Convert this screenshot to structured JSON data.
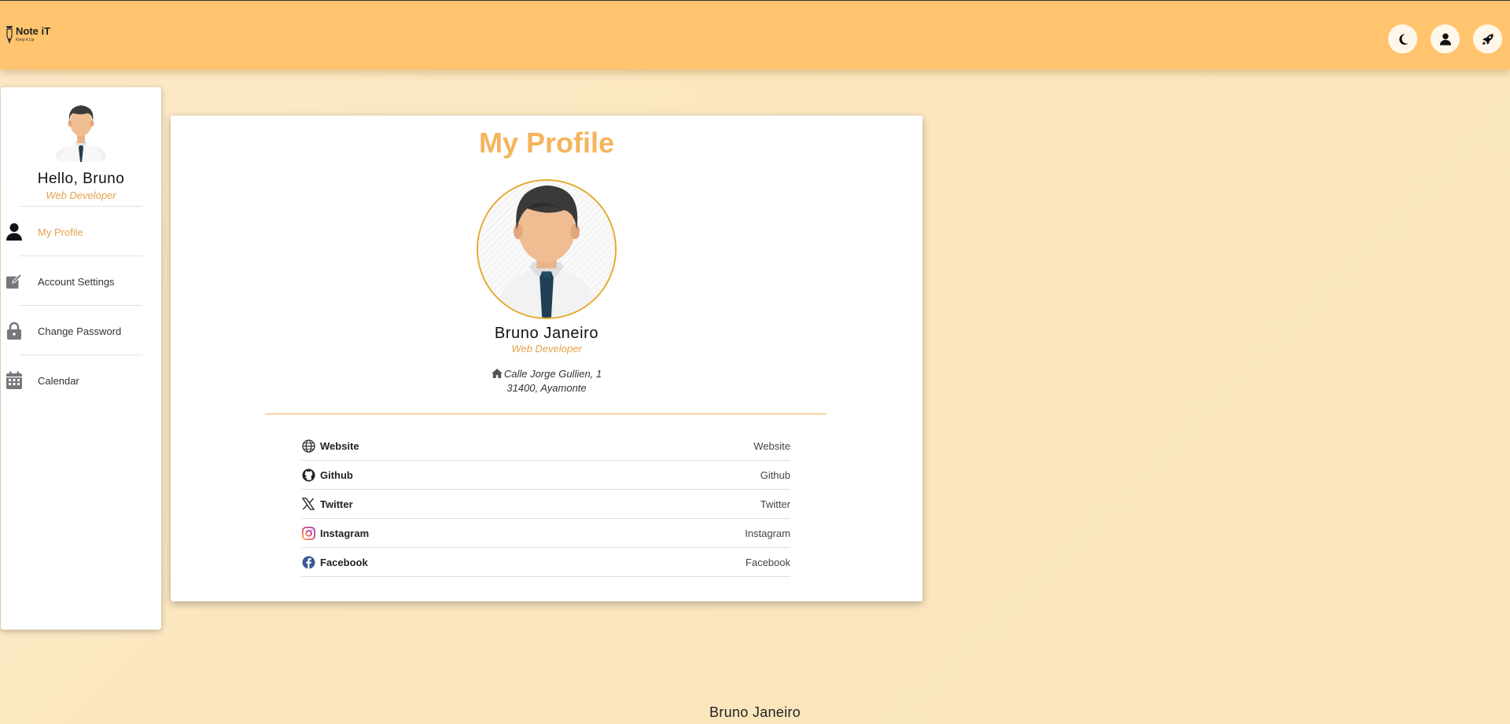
{
  "header": {
    "logo_name": "Note iT",
    "logo_tagline": "Keep it Up",
    "buttons": [
      {
        "icon": "moon-icon"
      },
      {
        "icon": "user-icon"
      },
      {
        "icon": "rocket-icon"
      }
    ]
  },
  "sidebar": {
    "greeting": "Hello, Bruno",
    "role": "Web Developer",
    "items": [
      {
        "label": "My Profile",
        "icon": "user-icon",
        "active": true
      },
      {
        "label": "Account Settings",
        "icon": "edit-icon"
      },
      {
        "label": "Change Password",
        "icon": "lock-icon"
      },
      {
        "label": "Calendar",
        "icon": "calendar-icon"
      }
    ]
  },
  "profile": {
    "title": "My Profile",
    "name": "Bruno Janeiro",
    "role": "Web Developer",
    "address_line1": "Calle Jorge Gullien, 1",
    "address_line2": "31400, Ayamonte",
    "links": [
      {
        "name": "Website",
        "value": "Website",
        "icon": "globe-icon"
      },
      {
        "name": "Github",
        "value": "Github",
        "icon": "github-icon"
      },
      {
        "name": "Twitter",
        "value": "Twitter",
        "icon": "x-twitter-icon"
      },
      {
        "name": "Instagram",
        "value": "Instagram",
        "icon": "instagram-icon"
      },
      {
        "name": "Facebook",
        "value": "Facebook",
        "icon": "facebook-icon"
      }
    ]
  },
  "colors": {
    "header_bg": "#ffc46d",
    "accent": "#f6b45c",
    "role_text": "#e4a24e",
    "avatar_border": "#e5a92b"
  },
  "footer": {
    "text": "Bruno Janeiro"
  }
}
